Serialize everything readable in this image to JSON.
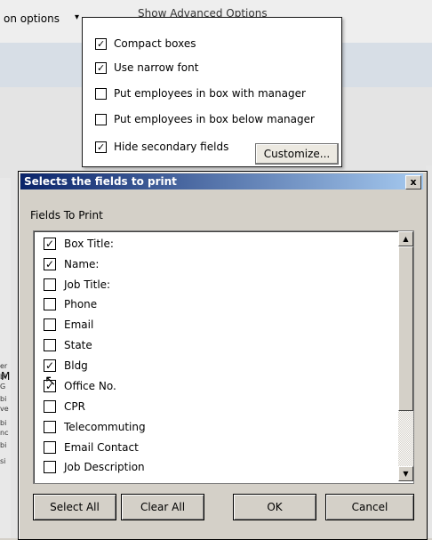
{
  "background": {
    "toolbar_tab": "on options",
    "toolbar_advanced": "Show Advanced Options",
    "left_letter": "M",
    "left_strip": [
      "er",
      "bi",
      "G",
      "bi",
      "ve",
      "bi",
      "nc",
      "bi",
      "si"
    ]
  },
  "dropdown": {
    "items": [
      {
        "label": "Compact boxes",
        "checked": true
      },
      {
        "label": "Use narrow font",
        "checked": true
      },
      {
        "label": "Put employees in box with manager",
        "checked": false
      },
      {
        "label": "Put employees in box below manager",
        "checked": false
      },
      {
        "label": "Hide secondary fields",
        "checked": true
      }
    ],
    "customize_label": "Customize..."
  },
  "dialog": {
    "title": "Selects the fields to print",
    "close_label": "x",
    "fields_label": "Fields To Print",
    "fields": [
      {
        "label": "Box Title:",
        "checked": true
      },
      {
        "label": "Name:",
        "checked": true
      },
      {
        "label": "Job Title:",
        "checked": false
      },
      {
        "label": "Phone",
        "checked": false
      },
      {
        "label": "Email",
        "checked": false
      },
      {
        "label": "State",
        "checked": false
      },
      {
        "label": "Bldg",
        "checked": true
      },
      {
        "label": "Office No.",
        "checked": true
      },
      {
        "label": "CPR",
        "checked": false
      },
      {
        "label": "Telecommuting",
        "checked": false
      },
      {
        "label": "Email Contact",
        "checked": false
      },
      {
        "label": "Job Description",
        "checked": false
      }
    ],
    "buttons": {
      "select_all": "Select All",
      "clear_all": "Clear All",
      "ok": "OK",
      "cancel": "Cancel"
    }
  },
  "colors": {
    "titlebar_start": "#0a246a",
    "titlebar_end": "#a6caf0",
    "dialog_face": "#d4d0c8"
  }
}
